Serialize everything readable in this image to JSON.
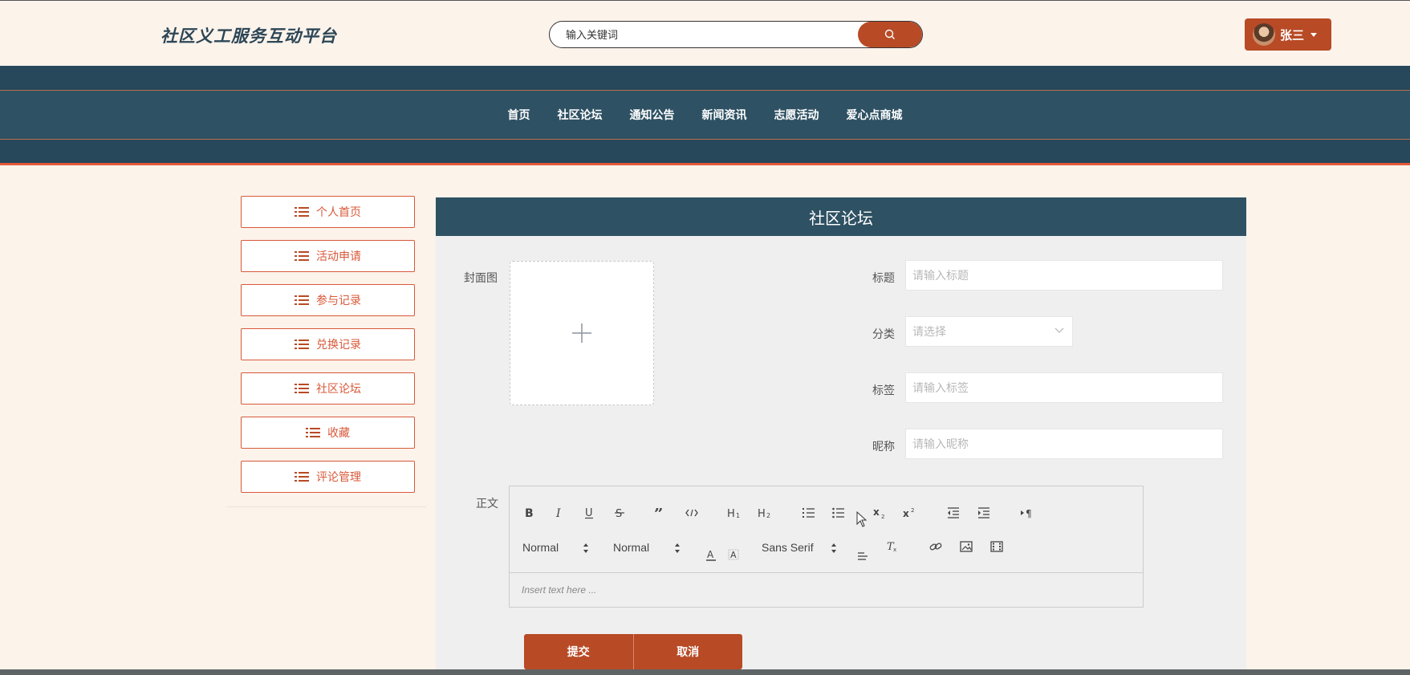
{
  "header": {
    "site_title": "社区义工服务互动平台",
    "search_placeholder": "输入关键词",
    "user_name": "张三"
  },
  "nav": {
    "items": [
      "首页",
      "社区论坛",
      "通知公告",
      "新闻资讯",
      "志愿活动",
      "爱心点商城"
    ]
  },
  "sidebar": {
    "items": [
      "个人首页",
      "活动申请",
      "参与记录",
      "兑换记录",
      "社区论坛",
      "收藏",
      "评论管理"
    ]
  },
  "main": {
    "title": "社区论坛",
    "form": {
      "cover_label": "封面图",
      "title_label": "标题",
      "title_placeholder": "请输入标题",
      "category_label": "分类",
      "category_placeholder": "请选择",
      "tags_label": "标签",
      "tags_placeholder": "请输入标签",
      "nickname_label": "昵称",
      "nickname_placeholder": "请输入昵称",
      "content_label": "正文"
    },
    "editor": {
      "header_select": "Normal",
      "size_select": "Normal",
      "font_select": "Sans Serif",
      "placeholder": "Insert text here ..."
    },
    "buttons": {
      "submit": "提交",
      "cancel": "取消"
    }
  },
  "colors": {
    "accent": "#b84a25",
    "nav_bg": "#27475a",
    "sidebar_border": "#d8593a",
    "page_bg": "#fcf3eb"
  }
}
